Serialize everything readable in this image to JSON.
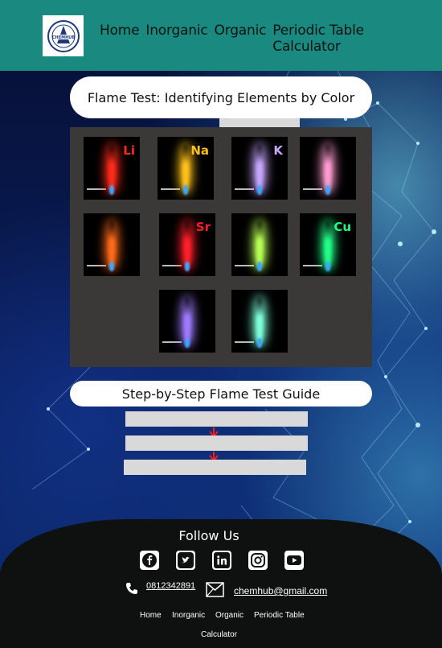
{
  "header": {
    "logo_text": "CHEMHUB",
    "nav": [
      "Home",
      "Inorganic",
      "Organic",
      "Periodic Table Calculator"
    ]
  },
  "gallery": {
    "title": "Flame Test: Identifying Elements by Color",
    "items": [
      {
        "symbol": "Li",
        "color": "#ff2a1a"
      },
      {
        "symbol": "Na",
        "color": "#ffc21a"
      },
      {
        "symbol": "K",
        "color": "#c7a6ff"
      },
      {
        "symbol": "",
        "color": "#ff9bd0"
      },
      {
        "symbol": "",
        "color": "#ff6a1a"
      },
      {
        "symbol": "Sr",
        "color": "#ff1f2a"
      },
      {
        "symbol": "",
        "color": "#b7ff55"
      },
      {
        "symbol": "Cu",
        "color": "#22ff88"
      },
      {
        "symbol": "",
        "color": "#a07bff"
      },
      {
        "symbol": "",
        "color": "#7dffd9"
      }
    ]
  },
  "guide": {
    "title": "Step-by-Step Flame Test Guide"
  },
  "footer": {
    "follow_label": "Follow Us",
    "social": [
      "facebook-icon",
      "twitter-icon",
      "linkedin-icon",
      "instagram-icon",
      "youtube-icon"
    ],
    "phone": "0812342891",
    "email": "chemhub@gmail.com",
    "nav": [
      "Home",
      "Inorganic",
      "Organic",
      "Periodic Table"
    ],
    "nav_wrap": "Calculator"
  },
  "colors": {
    "header_bg": "#1a8a80",
    "footer_bg": "#0f1111",
    "gallery_bg": "#3b3937",
    "arrow": "#ff1a1a"
  }
}
